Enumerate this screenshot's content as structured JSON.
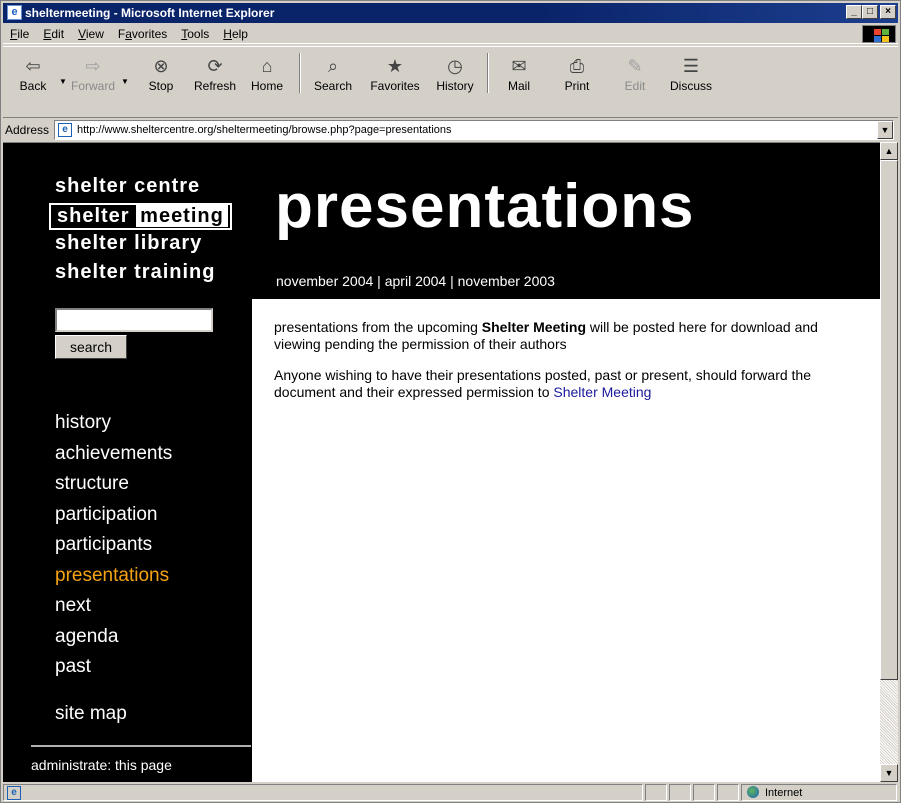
{
  "window": {
    "title": "sheltermeeting - Microsoft Internet Explorer",
    "controls": [
      "_",
      "□",
      "×"
    ]
  },
  "menu": {
    "items": [
      {
        "label": "File",
        "key": "F",
        "rest": "ile"
      },
      {
        "label": "Edit",
        "key": "E",
        "rest": "dit"
      },
      {
        "label": "View",
        "key": "V",
        "rest": "iew"
      },
      {
        "label": "Favorites",
        "key": "a",
        "pre": "F",
        "rest": "vorites"
      },
      {
        "label": "Tools",
        "key": "T",
        "rest": "ools"
      },
      {
        "label": "Help",
        "key": "H",
        "rest": "elp"
      }
    ]
  },
  "toolbar": {
    "back": "Back",
    "forward": "Forward",
    "stop": "Stop",
    "refresh": "Refresh",
    "home": "Home",
    "search": "Search",
    "favorites": "Favorites",
    "history": "History",
    "mail": "Mail",
    "print": "Print",
    "edit": "Edit",
    "discuss": "Discuss"
  },
  "address": {
    "label": "Address",
    "url": "http://www.sheltercentre.org/sheltermeeting/browse.php?page=presentations"
  },
  "page": {
    "brand": {
      "centre": "shelter  centre",
      "meeting_a": "shelter",
      "meeting_b": "meeting",
      "library": "shelter  library",
      "training": "shelter  training"
    },
    "search": {
      "value": "",
      "button": "search"
    },
    "nav": [
      "history",
      "achievements",
      "structure",
      "participation",
      "participants",
      "presentations",
      "next",
      "agenda",
      "past"
    ],
    "active_nav": "presentations",
    "sitemap": "site map",
    "admin": "administrate: this page",
    "title": "presentations",
    "dates": [
      "november 2004",
      "april 2004",
      "november 2003"
    ],
    "date_sep": " | ",
    "para1_pre": "presentations from the upcoming ",
    "para1_bold": "Shelter Meeting",
    "para1_post": " will be posted here for download and viewing pending the permission of their authors",
    "para2_pre": "Anyone wishing to have their presentations posted, past or present, should forward the document and their expressed permission to ",
    "para2_link": "Shelter Meeting"
  },
  "status": {
    "zone": "Internet"
  },
  "colors": {
    "active_link": "#f5a313",
    "link": "#1a1a9c",
    "titlebar": "#0a246a"
  }
}
